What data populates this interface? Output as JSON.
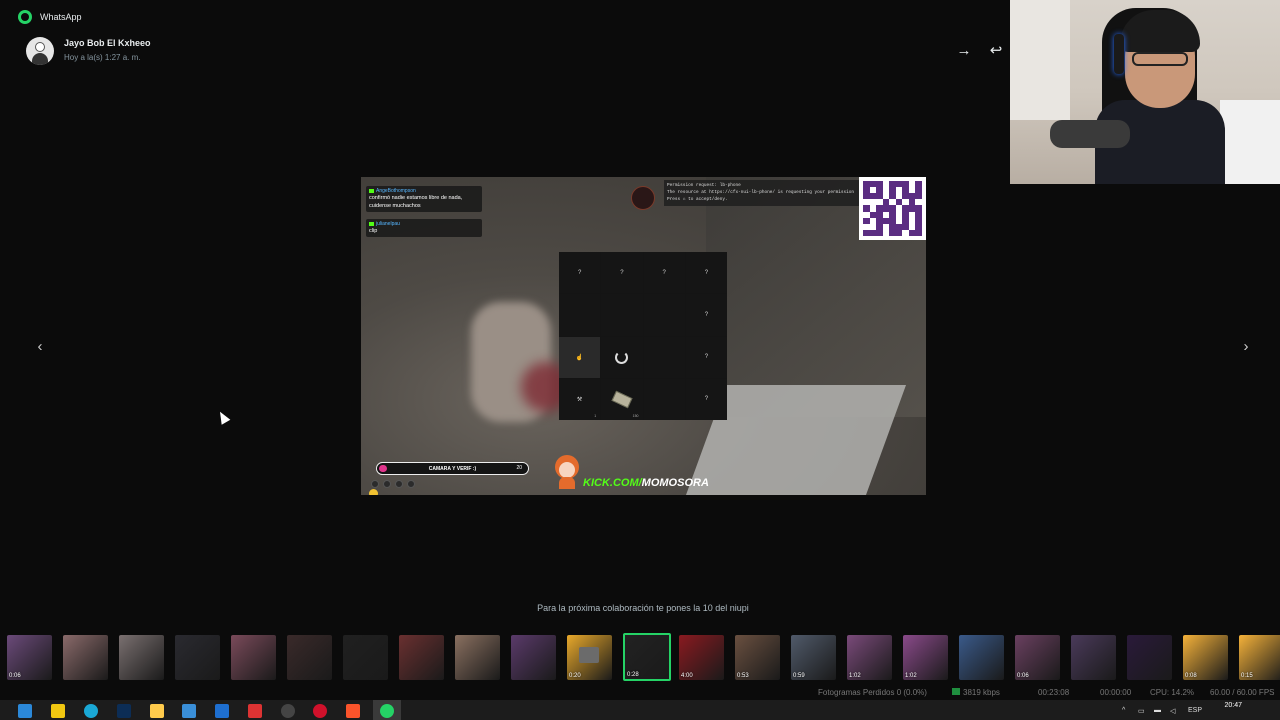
{
  "app": {
    "title": "WhatsApp"
  },
  "viewer": {
    "sender_name": "Jayo Bob El Kxheeo",
    "timestamp": "Hoy a la(s) 1:27 a. m.",
    "caption": "Para la próxima colaboración te pones la 10 del niupi",
    "forward_icon": "→",
    "reply_icon": "↩",
    "prev_icon": "‹",
    "next_icon": "›"
  },
  "stream": {
    "chat": [
      {
        "user": "AngeBothompson",
        "message": "confirmó nadie estamos libre de nada, cuidense muchachos"
      },
      {
        "user": "julianelpau",
        "message": "clip"
      }
    ],
    "permission": [
      "Permission request: lb-phone",
      "The resource at https://cfx-nui-lb-phone/ is requesting your permission",
      "Press ⌂ to accept/deny."
    ],
    "puzzle_cells": [
      "?",
      "?",
      "?",
      "?",
      "",
      "",
      "",
      "?",
      "",
      "",
      "",
      "?",
      "",
      "",
      "",
      "?"
    ],
    "puzzle_sub_a": "1",
    "puzzle_sub_b": "150",
    "goal_label": "CAMARA Y VERIF :)",
    "goal_count": "20",
    "goal_progress": 0.05,
    "kick_a": "KICK.COM/",
    "kick_b": "MOMOSORA"
  },
  "thumbnails": [
    {
      "duration": "0:06",
      "color": "#6b4a7a"
    },
    {
      "duration": "",
      "color": "#8a6a6a"
    },
    {
      "duration": "",
      "color": "#7a7070"
    },
    {
      "duration": "",
      "color": "#2a2a30"
    },
    {
      "duration": "",
      "color": "#7a4a5a"
    },
    {
      "duration": "",
      "color": "#3a2a2a"
    },
    {
      "duration": "",
      "color": "#202020"
    },
    {
      "duration": "",
      "color": "#6a3030"
    },
    {
      "duration": "",
      "color": "#8a7060"
    },
    {
      "duration": "",
      "color": "#5a3a6a"
    },
    {
      "duration": "0:20",
      "color": "#e9a92b"
    },
    {
      "duration": "0:28",
      "color": "#222222"
    },
    {
      "duration": "4:00",
      "color": "#8a1a20"
    },
    {
      "duration": "0:53",
      "color": "#6a5040"
    },
    {
      "duration": "0:59",
      "color": "#505a6a"
    },
    {
      "duration": "1:02",
      "color": "#7a4a7a"
    },
    {
      "duration": "1:02",
      "color": "#8a4a8a"
    },
    {
      "duration": "",
      "color": "#3a5a8a"
    },
    {
      "duration": "0:06",
      "color": "#6a4060"
    },
    {
      "duration": "",
      "color": "#4a3a5a"
    },
    {
      "duration": "",
      "color": "#2a1a3a"
    },
    {
      "duration": "0:08",
      "color": "#f5b23a"
    },
    {
      "duration": "0:15",
      "color": "#f5b23a"
    }
  ],
  "obs_stats": {
    "dropped_frames": "Fotogramas Perdidos 0 (0.0%)",
    "bitrate": "3819 kbps",
    "stream_time": "00:23:08",
    "rec_time": "00:00:00",
    "cpu": "CPU: 14.2%",
    "fps": "60.00 / 60.00 FPS"
  },
  "taskbar": {
    "language": "ESP",
    "time": "20:47",
    "date": "",
    "icons": [
      "windows-start-icon",
      "file-explorer-icon",
      "edge-icon",
      "photoshop-icon",
      "folder-icon",
      "store-icon",
      "mail-icon",
      "browser-icon",
      "obs-icon",
      "opera-icon",
      "brave-icon",
      "whatsapp-icon"
    ]
  },
  "colors": {
    "accent": "#25d366",
    "background": "#0b0b0b",
    "kick_green": "#53fc18"
  }
}
